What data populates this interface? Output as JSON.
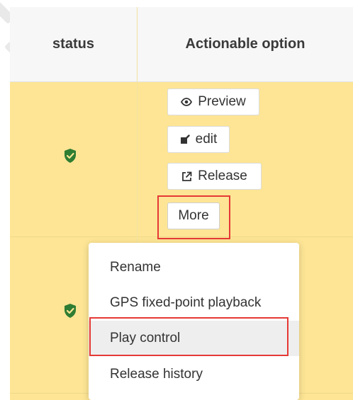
{
  "table": {
    "headers": {
      "status": "status",
      "action": "Actionable option"
    },
    "rows": [
      {
        "status_icon": "check-shield-icon"
      },
      {
        "status_icon": "check-shield-icon"
      }
    ]
  },
  "row_actions": {
    "preview": {
      "label": "Preview",
      "icon": "eye-icon"
    },
    "edit": {
      "label": "edit",
      "icon": "edit-icon"
    },
    "release": {
      "label": "Release",
      "icon": "external-link-icon"
    },
    "more": {
      "label": "More"
    }
  },
  "more_menu": {
    "items": [
      {
        "label": "Rename"
      },
      {
        "label": "GPS fixed-point playback"
      },
      {
        "label": "Play control"
      },
      {
        "label": "Release history"
      }
    ],
    "hovered_index": 2
  },
  "colors": {
    "row_highlight": "#fde595",
    "status_ok": "#2e7d32",
    "annotation_red": "#e53935"
  }
}
